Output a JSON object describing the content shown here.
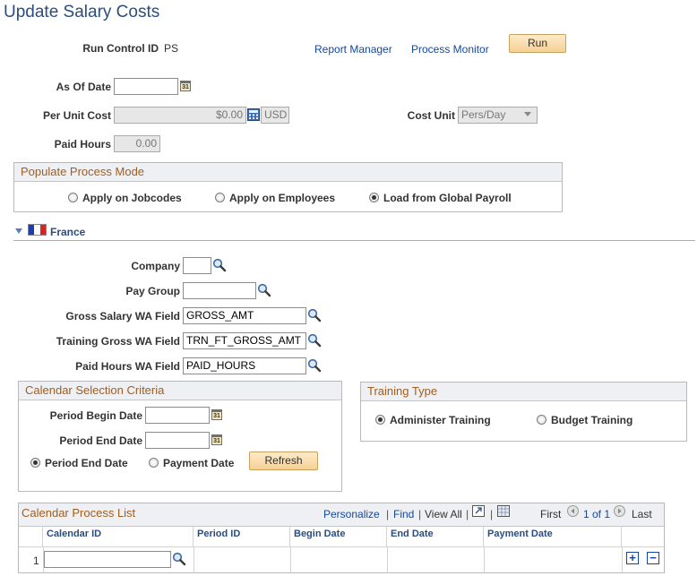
{
  "page": {
    "title": "Update Salary Costs"
  },
  "run_control": {
    "label": "Run Control ID",
    "value": "PS",
    "report_manager": "Report Manager",
    "process_monitor": "Process Monitor",
    "run_button": "Run"
  },
  "fields": {
    "as_of_date": {
      "label": "As Of Date",
      "value": ""
    },
    "per_unit_cost": {
      "label": "Per Unit Cost",
      "value": "$0.00",
      "currency": "USD"
    },
    "cost_unit": {
      "label": "Cost Unit",
      "value": "Pers/Day"
    },
    "paid_hours": {
      "label": "Paid Hours",
      "value": "0.00"
    }
  },
  "populate_mode": {
    "title": "Populate Process Mode",
    "options": [
      "Apply on Jobcodes",
      "Apply on Employees",
      "Load from Global Payroll"
    ],
    "selected": "Load from Global Payroll"
  },
  "country": {
    "name": "France"
  },
  "france": {
    "company": {
      "label": "Company",
      "value": ""
    },
    "pay_group": {
      "label": "Pay Group",
      "value": ""
    },
    "gross_salary": {
      "label": "Gross Salary WA Field",
      "value": "GROSS_AMT"
    },
    "training_gross": {
      "label": "Training Gross WA Field",
      "value": "TRN_FT_GROSS_AMT"
    },
    "paid_hours_wa": {
      "label": "Paid Hours WA Field",
      "value": "PAID_HOURS"
    }
  },
  "calendar_criteria": {
    "title": "Calendar Selection Criteria",
    "period_begin": {
      "label": "Period Begin Date",
      "value": ""
    },
    "period_end": {
      "label": "Period End Date",
      "value": ""
    },
    "radio_period_end": "Period End Date",
    "radio_payment": "Payment Date",
    "selected": "Period End Date",
    "refresh_button": "Refresh"
  },
  "training_type": {
    "title": "Training Type",
    "option_administer": "Administer Training",
    "option_budget": "Budget Training",
    "selected": "Administer Training"
  },
  "calendar_list": {
    "title": "Calendar Process List",
    "personalize": "Personalize",
    "find": "Find",
    "view_all": "View All",
    "first": "First",
    "count": "1 of 1",
    "last": "Last",
    "columns": [
      "Calendar ID",
      "Period ID",
      "Begin Date",
      "End Date",
      "Payment Date"
    ],
    "rows": [
      {
        "num": "1",
        "calendar_id": ""
      }
    ]
  },
  "colors": {
    "title": "#2a4d7f",
    "link": "#14479c",
    "group_title": "#a25d1e",
    "button": "#f6d095"
  },
  "icons": [
    "calendar-icon",
    "lookup-icon",
    "calculator-icon",
    "flag-france-icon",
    "collapse-arrow-icon",
    "zoom-grid-icon",
    "download-grid-icon",
    "prev-arrow-icon",
    "next-arrow-icon",
    "add-row-icon",
    "delete-row-icon"
  ]
}
